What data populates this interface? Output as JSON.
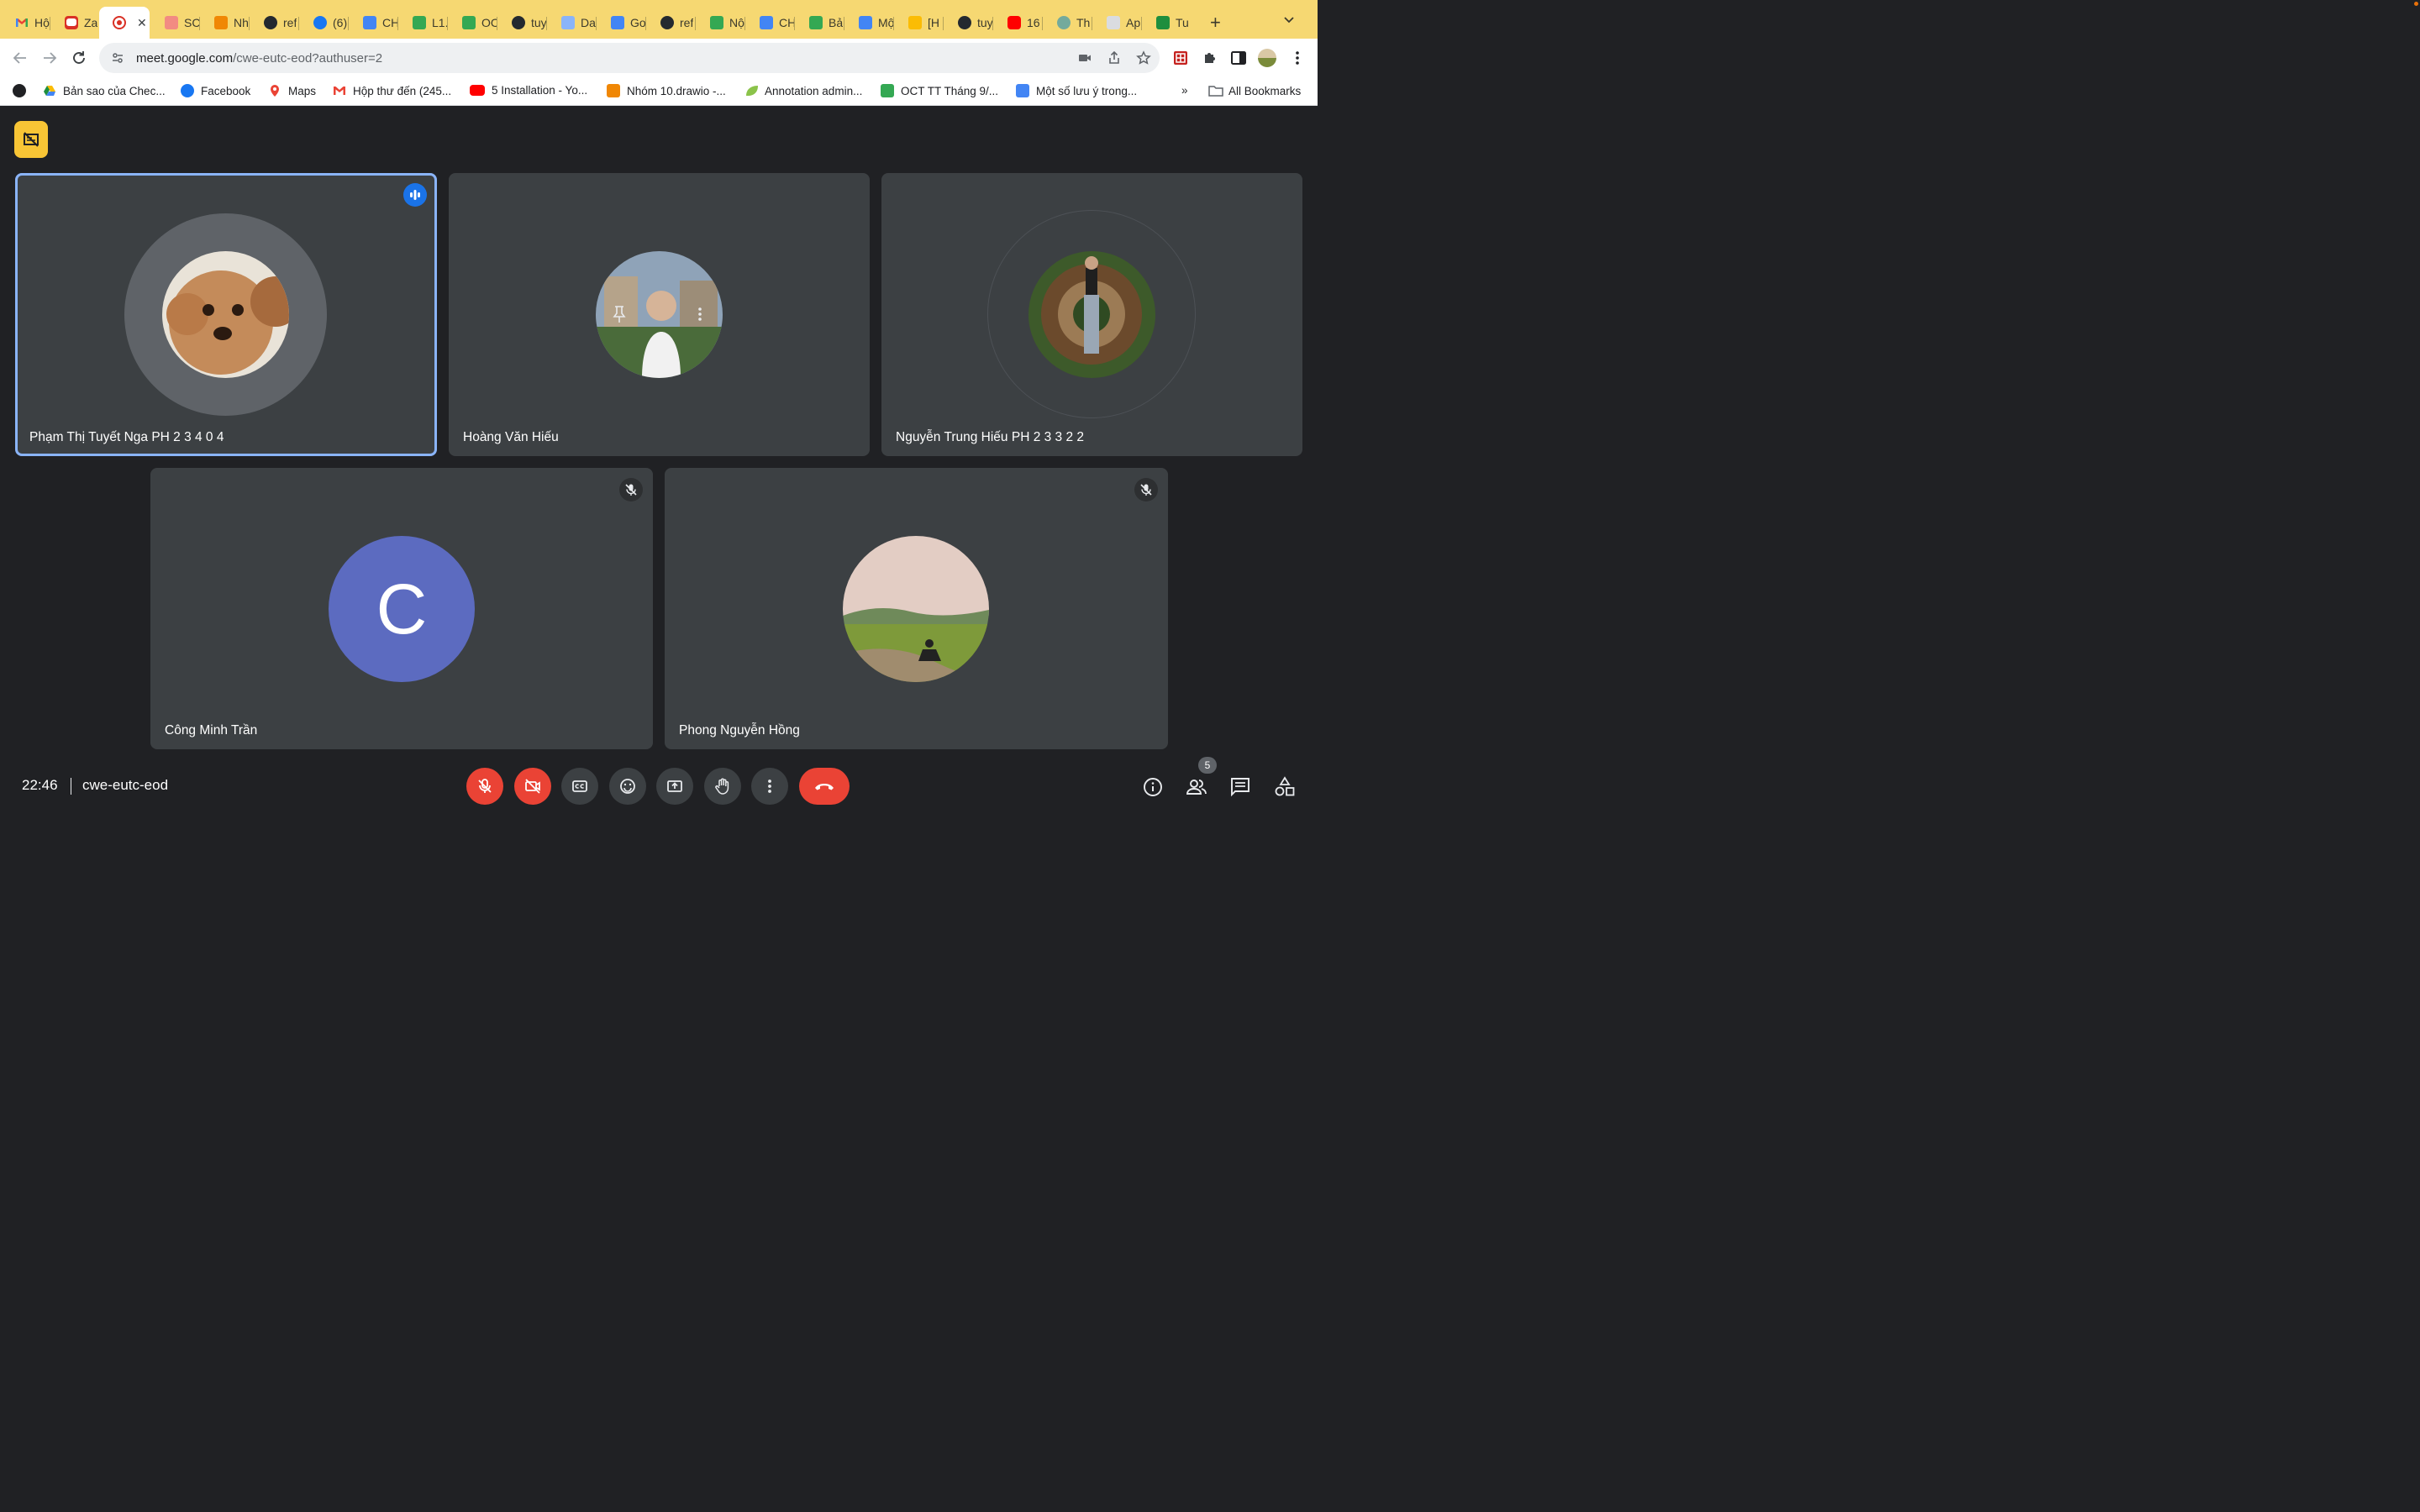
{
  "browser": {
    "tabs": [
      {
        "label": "Hộ",
        "icon": "gmail-icon"
      },
      {
        "label": "Za",
        "icon": "zalo-icon"
      },
      {
        "label": "",
        "icon": "recording-icon",
        "active": true
      },
      {
        "label": "SC",
        "icon": "app-icon"
      },
      {
        "label": "Nh",
        "icon": "drawio-icon"
      },
      {
        "label": "ref",
        "icon": "github-icon"
      },
      {
        "label": "(6)",
        "icon": "facebook-icon"
      },
      {
        "label": "CH",
        "icon": "docs-icon"
      },
      {
        "label": "L1.",
        "icon": "sheets-icon"
      },
      {
        "label": "OC",
        "icon": "sheets-icon"
      },
      {
        "label": "tuy",
        "icon": "github-icon"
      },
      {
        "label": "Da",
        "icon": "app-icon"
      },
      {
        "label": "Go",
        "icon": "translate-icon"
      },
      {
        "label": "ref",
        "icon": "github-icon"
      },
      {
        "label": "Nộ",
        "icon": "sheets-icon"
      },
      {
        "label": "CH",
        "icon": "docs-icon"
      },
      {
        "label": "Bả",
        "icon": "sheets-icon"
      },
      {
        "label": "Mộ",
        "icon": "docs-icon"
      },
      {
        "label": "[H",
        "icon": "app-icon"
      },
      {
        "label": "tuy",
        "icon": "github-icon"
      },
      {
        "label": "16",
        "icon": "youtube-icon"
      },
      {
        "label": "Th",
        "icon": "chatgpt-icon"
      },
      {
        "label": "Ap",
        "icon": "app-icon"
      },
      {
        "label": "Tu",
        "icon": "app-icon"
      }
    ],
    "tab_close": "✕",
    "new_tab": "+",
    "url": {
      "host": "meet.google.com",
      "path": "/cwe-eutc-eod?authuser=2"
    },
    "bookmarks": [
      {
        "label": "",
        "icon": "globe-icon"
      },
      {
        "label": "Bản sao của Chec...",
        "icon": "drive-icon"
      },
      {
        "label": "Facebook",
        "icon": "facebook-icon"
      },
      {
        "label": "Maps",
        "icon": "maps-icon"
      },
      {
        "label": "Hộp thư đến (245...",
        "icon": "gmail-icon"
      },
      {
        "label": "5 Installation - Yo...",
        "icon": "youtube-icon"
      },
      {
        "label": "Nhóm 10.drawio -...",
        "icon": "drawio-icon"
      },
      {
        "label": "Annotation admin...",
        "icon": "leaf-icon"
      },
      {
        "label": "OCT TT Tháng 9/...",
        "icon": "sheets-icon"
      },
      {
        "label": "Một số lưu ý trong...",
        "icon": "docs-icon"
      }
    ],
    "bookmarks_overflow": "»",
    "all_bookmarks": "All Bookmarks"
  },
  "meet": {
    "participants": [
      {
        "name": "Phạm Thị Tuyết Nga PH 2 3 4 0 4",
        "speaking": true,
        "muted": false
      },
      {
        "name": "Hoàng Văn Hiếu",
        "speaking": false,
        "muted": false
      },
      {
        "name": "Nguyễn Trung Hiếu PH 2 3 3 2 2",
        "speaking": false,
        "muted": false
      },
      {
        "name": "Công Minh Trần",
        "speaking": false,
        "muted": true,
        "initial": "C"
      },
      {
        "name": "Phong Nguyễn Hồng",
        "speaking": false,
        "muted": true
      }
    ],
    "time": "22:46",
    "meeting_code": "cwe-eutc-eod",
    "people_count": "5"
  },
  "colors": {
    "tab_strip": "#f6d872",
    "stage": "#202124",
    "tile": "#3c4043",
    "speaking_outline": "#8ab4f8",
    "danger": "#ea4335",
    "initial_avatar": "#5c6bc0",
    "recording_badge": "#f8c535"
  }
}
